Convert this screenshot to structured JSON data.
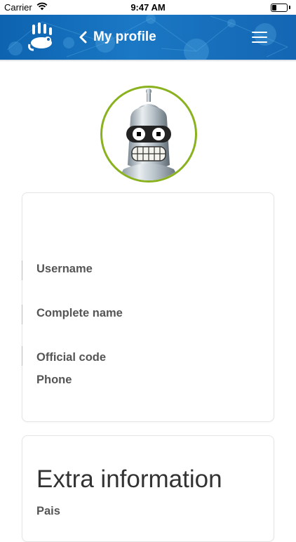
{
  "status_bar": {
    "carrier": "Carrier",
    "time": "9:47 AM"
  },
  "header": {
    "back_label": "My profile",
    "brand_color": "#1466b3"
  },
  "avatar": {
    "ring_color": "#8ab21f"
  },
  "profile_card": {
    "username_label": "Username",
    "complete_name_label": "Complete name",
    "official_code_label": "Official code",
    "phone_label": "Phone"
  },
  "extra_card": {
    "title": "Extra information",
    "pais_label": "Pais"
  }
}
